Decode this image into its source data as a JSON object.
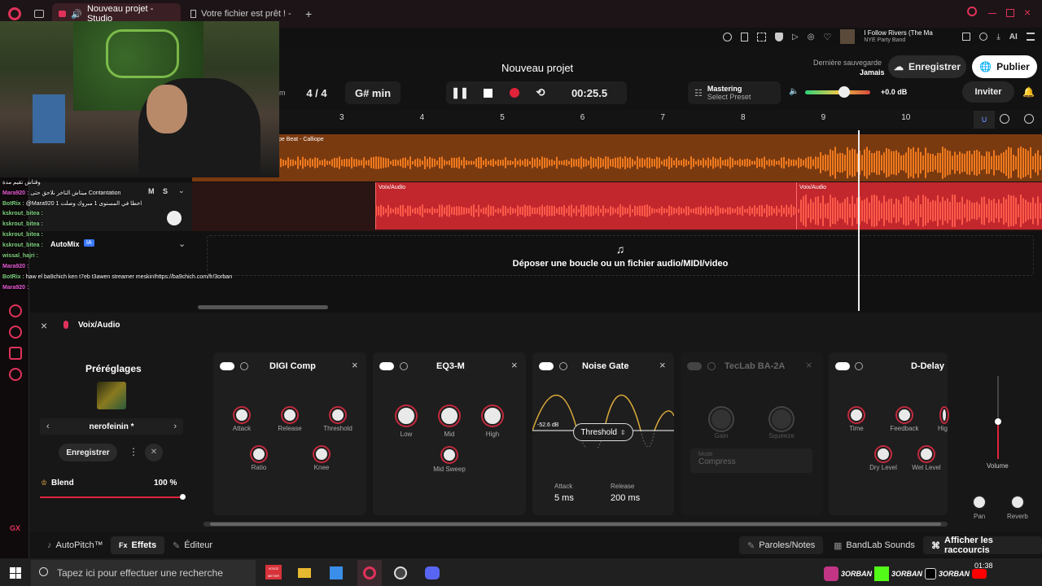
{
  "browser": {
    "tabs": [
      {
        "label": "Nouveau projet - Studio"
      },
      {
        "label": "Votre fichier est prêt ! - no†"
      }
    ],
    "now_playing": {
      "title": "I Follow Rivers (The Ma",
      "subtitle": "NYE Party Band"
    },
    "ai_label": "AI"
  },
  "header": {
    "project_title": "Nouveau projet",
    "last_save_label": "Dernière sauvegarde",
    "last_save_value": "Jamais",
    "save_button": "Enregistrer",
    "publish_button": "Publier",
    "invite_button": "Inviter",
    "bpm_suffix": "m",
    "time_sig": "4 / 4",
    "key": "G# min",
    "time": "00:25.5",
    "mastering_title": "Mastering",
    "mastering_preset": "Select Preset",
    "volume_db": "+0.0 dB",
    "volume_level": 0.6
  },
  "ruler": {
    "ticks": [
      "3",
      "4",
      "5",
      "6",
      "7",
      "8",
      "9",
      "10"
    ]
  },
  "tracks": {
    "track1_region": "pe Beat - Calliope",
    "track2_name": "Voix/Audio",
    "track2_regions": [
      "Voix/Audio",
      "Voix/Audio"
    ],
    "mute": "M",
    "solo": "S",
    "automix": "AutoMix",
    "ia_badge": "IA"
  },
  "dropzone": {
    "text": "Déposer une boucle ou un fichier audio/MIDI/video"
  },
  "chat": [
    {
      "user": "",
      "msg": "وقتاش تقيم مدة"
    },
    {
      "user": "Mara920",
      "msg": "ميتاش التاخر نلاحق حتى Contantation"
    },
    {
      "user": "BotRix",
      "msg": "@Mara920 اخطا في المستوى 1 مبروك وصلت 1"
    },
    {
      "user": "kskrout_bitea",
      "msg": ""
    },
    {
      "user": "kskrout_bitea",
      "msg": ""
    },
    {
      "user": "kskrout_bitea",
      "msg": ""
    },
    {
      "user": "kskrout_bitea",
      "msg": ""
    },
    {
      "user": "wissal_hajri",
      "msg": ""
    },
    {
      "user": "Mara920",
      "msg": ""
    },
    {
      "user": "BotRix",
      "msg": "haw el ba9chich ken t7eb t3awen streamer meskin!https://ba9chich.com/fr/3orban"
    },
    {
      "user": "Mara920",
      "msg": ""
    }
  ],
  "fx": {
    "panel_title": "Voix/Audio",
    "presets_title": "Préréglages",
    "preset_name": "nerofeinin *",
    "preset_save": "Enregistrer",
    "blend_label": "Blend",
    "blend_value": "100 %",
    "blend_level": 1.0,
    "digi": {
      "title": "DIGI Comp",
      "knobs": [
        "Attack",
        "Release",
        "Threshold",
        "Ratio",
        "Knee"
      ]
    },
    "eq": {
      "title": "EQ3-M",
      "knobs": [
        "Low",
        "Mid",
        "High",
        "Mid Sweep"
      ]
    },
    "gate": {
      "title": "Noise Gate",
      "db": "-52.6 dB",
      "threshold_label": "Threshold",
      "attack_label": "Attack",
      "attack_value": "5 ms",
      "release_label": "Release",
      "release_value": "200 ms"
    },
    "teclab": {
      "title": "TecLab BA-2A",
      "knobs": [
        "Gain",
        "Squeeze"
      ],
      "mode_label": "Mode",
      "mode_value": "Compress"
    },
    "delay": {
      "title": "D-Delay",
      "knobs": [
        "Time",
        "Feedback",
        "Hig",
        "Dry Level",
        "Wet Level"
      ]
    },
    "volume_label": "Volume",
    "pan_label": "Pan",
    "reverb_label": "Reverb"
  },
  "bottombar": {
    "autopitch": "AutoPitch™",
    "effets": "Effets",
    "fx_prefix": "Fx",
    "editeur": "Éditeur",
    "paroles": "Paroles/Notes",
    "bandlab": "BandLab Sounds",
    "shortcuts": "Afficher les raccourcis"
  },
  "taskbar": {
    "search_placeholder": "Tapez ici pour effectuer une recherche",
    "clock": "01:38",
    "handle": "3ORBAN",
    "voice_badge": "VOICE METER"
  },
  "sidebar": {
    "gx": "GX"
  },
  "colors": {
    "accent": "#e0325a",
    "track1": "#f07a1e",
    "track2": "#d63a2a"
  }
}
